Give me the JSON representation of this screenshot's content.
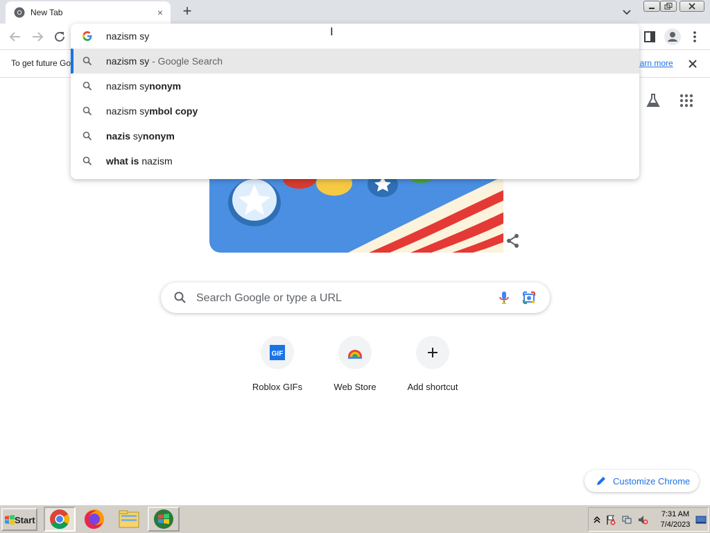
{
  "tab": {
    "title": "New Tab",
    "close_glyph": "×"
  },
  "new_tab_glyph": "+",
  "omnibox": {
    "typed": "nazism sy",
    "suggestions": [
      {
        "plain": "nazism sy",
        "bold": "",
        "suffix": " - Google Search",
        "selected": true
      },
      {
        "plain": "nazism sy",
        "bold": "nonym",
        "suffix": "",
        "selected": false
      },
      {
        "plain": "nazism sy",
        "bold": "mbol copy",
        "suffix": "",
        "selected": false
      },
      {
        "plain_pre_bold": "nazis",
        "plain": " sy",
        "bold": "nonym",
        "suffix": "",
        "selected": false
      },
      {
        "plain_pre_bold": "what is",
        "plain": " nazism",
        "bold": "",
        "suffix": "",
        "selected": false
      }
    ]
  },
  "infobar": {
    "text": "To get future Go",
    "link": "earn more"
  },
  "search": {
    "placeholder": "Search Google or type a URL"
  },
  "shortcuts": [
    {
      "label": "Roblox GIFs",
      "icon": "gif-icon"
    },
    {
      "label": "Web Store",
      "icon": "web-store-icon"
    },
    {
      "label": "Add shortcut",
      "icon": "plus-icon"
    }
  ],
  "customize": {
    "label": "Customize Chrome"
  },
  "taskbar": {
    "start_label": "Start",
    "time": "7:31 AM",
    "date": "7/4/2023"
  },
  "colors": {
    "accent": "#1a73e8",
    "selected_row": "#e8e8e8",
    "doodle_blue": "#4a90e2",
    "doodle_red": "#e53935"
  }
}
